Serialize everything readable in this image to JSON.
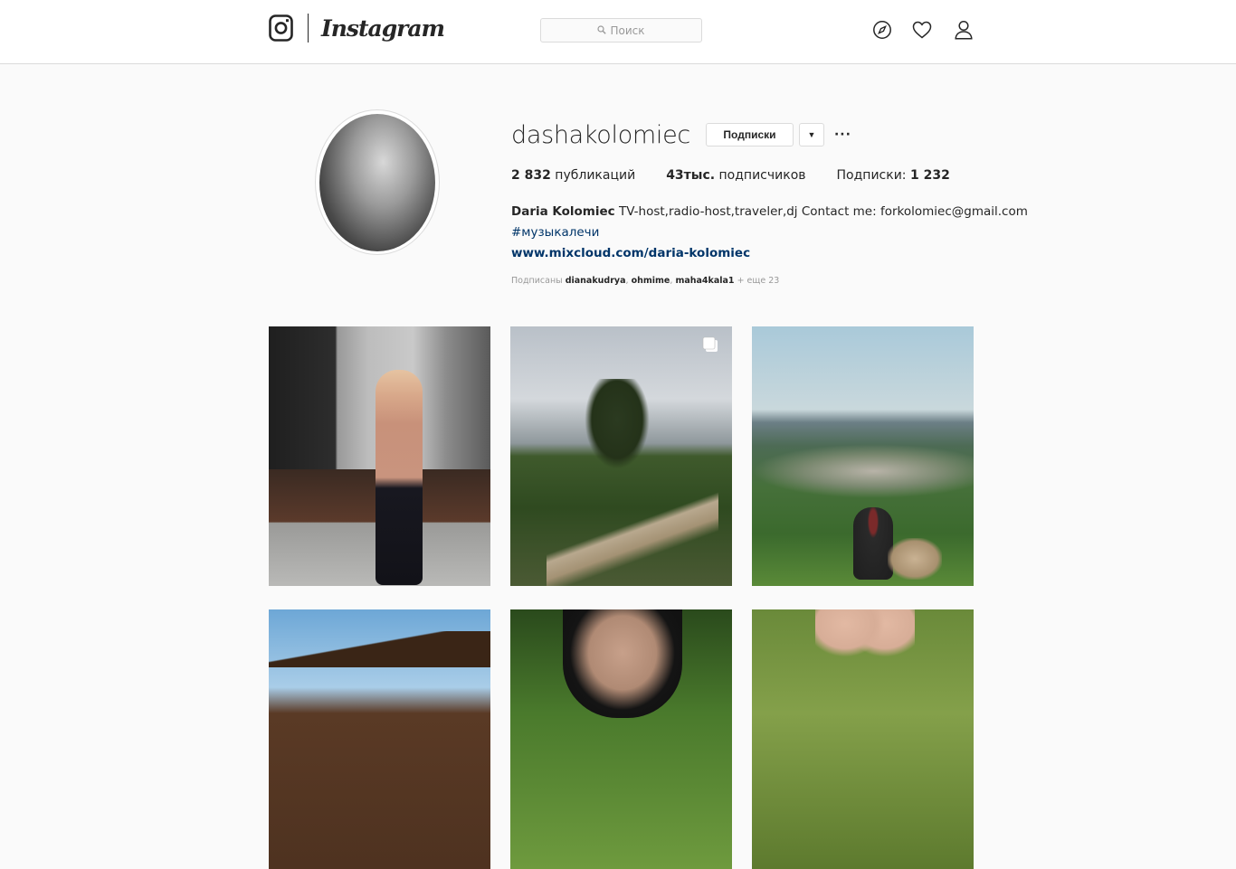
{
  "nav": {
    "brand": "Instagram",
    "search_placeholder": "Поиск",
    "icons": [
      "instagram-camera-icon",
      "search-icon",
      "explore-compass-icon",
      "heart-icon",
      "profile-person-icon"
    ]
  },
  "profile": {
    "username": "dashakolomiec",
    "follow_button": "Подписки",
    "dropdown_label": "▼",
    "more_label": "···",
    "stats": {
      "posts_count": "2 832",
      "posts_label": "публикаций",
      "followers_count": "43тыс.",
      "followers_label": "подписчиков",
      "following_label": "Подписки:",
      "following_count": "1 232"
    },
    "bio": {
      "full_name": "Daria Kolomiec",
      "text": "TV-host,radio-host,traveler,dj Contact me: forkolomiec@gmail.com",
      "hashtag": "#музыкалечи",
      "link": "www.mixcloud.com/daria-kolomiec"
    },
    "followed_by": {
      "prefix": "Подписаны",
      "users": [
        "dianakudrya",
        "ohmime",
        "maha4kala1"
      ],
      "separator": ",",
      "suffix": "+ еще 23"
    }
  },
  "colors": {
    "background": "#fafafa",
    "border": "#dbdbdb",
    "text": "#262626",
    "link": "#003569",
    "muted": "#999999"
  }
}
